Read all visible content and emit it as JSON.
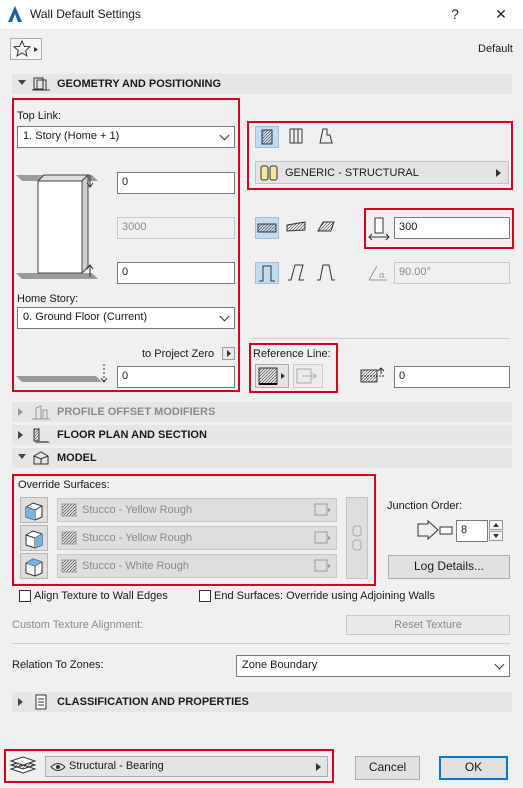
{
  "window": {
    "title": "Wall Default Settings",
    "help": "?",
    "close": "✕"
  },
  "header": {
    "favorites_label": "",
    "default_label": "Default"
  },
  "sections": {
    "geometry": "GEOMETRY AND POSITIONING",
    "profile": "PROFILE OFFSET MODIFIERS",
    "floorplan": "FLOOR PLAN AND SECTION",
    "model": "MODEL",
    "classification": "CLASSIFICATION AND PROPERTIES"
  },
  "geometry": {
    "top_link_label": "Top Link:",
    "top_link_value": "1. Story (Home + 1)",
    "top_offset": "0",
    "height": "3000",
    "bottom_offset": "0",
    "home_story_label": "Home Story:",
    "home_story_value": "0. Ground Floor (Current)",
    "to_project_zero_label": "to Project Zero",
    "project_zero_value": "0",
    "building_material": "GENERIC - STRUCTURAL",
    "thickness": "300",
    "slant_angle": "90.00°",
    "reference_line_label": "Reference Line:",
    "reference_offset": "0"
  },
  "model": {
    "override_surfaces_label": "Override Surfaces:",
    "surfaces": [
      "Stucco - Yellow Rough",
      "Stucco - Yellow Rough",
      "Stucco - White Rough"
    ],
    "junction_order_label": "Junction Order:",
    "junction_order_value": "8",
    "log_details": "Log Details...",
    "align_texture": "Align Texture to Wall Edges",
    "end_surfaces": "End Surfaces: Override using Adjoining Walls",
    "custom_texture_label": "Custom Texture Alignment:",
    "reset_texture": "Reset Texture"
  },
  "zones": {
    "label": "Relation To Zones:",
    "value": "Zone Boundary"
  },
  "footer": {
    "layer": "Structural - Bearing",
    "cancel": "Cancel",
    "ok": "OK"
  },
  "colors": {
    "highlight": "#d6001c",
    "selected": "#c5dcf0",
    "primary_border": "#0078d7"
  }
}
